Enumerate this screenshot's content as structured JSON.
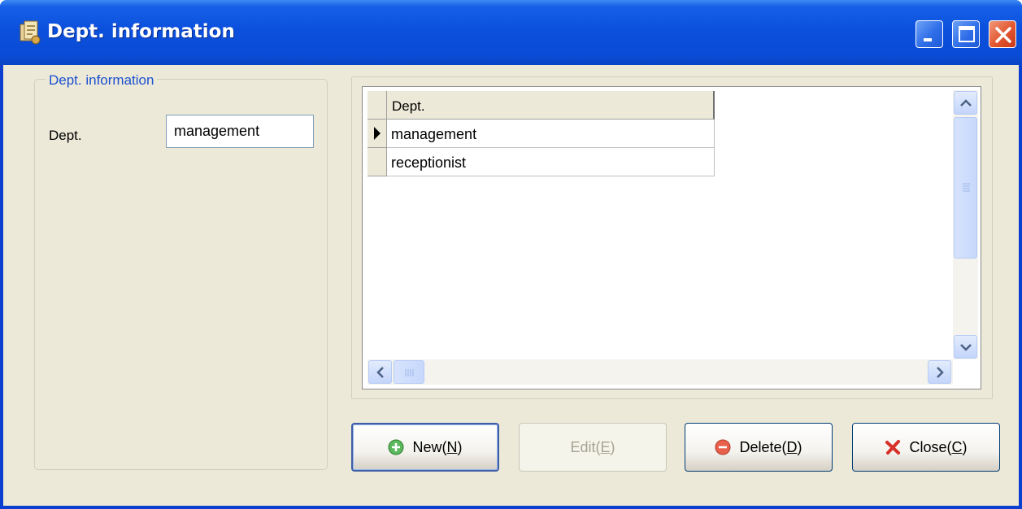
{
  "window": {
    "title": "Dept. information",
    "controls": {
      "minimize": "minimize-icon",
      "maximize": "maximize-icon",
      "close": "close-icon"
    }
  },
  "group": {
    "legend": "Dept. information",
    "dept_label": "Dept.",
    "dept_value": "management"
  },
  "grid": {
    "column_header": "Dept.",
    "rows": [
      {
        "value": "management",
        "current": true
      },
      {
        "value": "receptionist",
        "current": false
      }
    ]
  },
  "buttons": {
    "new": {
      "text": "New(",
      "key": "N",
      "end": ")",
      "icon": "plus-circle-icon",
      "enabled": true
    },
    "edit": {
      "text": "Edit(",
      "key": "E",
      "end": ")",
      "enabled": false
    },
    "delete": {
      "text": "Delete(",
      "key": "D",
      "end": ")",
      "icon": "minus-circle-icon",
      "enabled": true
    },
    "close": {
      "text": "Close(",
      "key": "C",
      "end": ")",
      "icon": "red-x-icon",
      "enabled": true
    }
  },
  "colors": {
    "titlebar": "#0a4bd6",
    "client_background": "#ece9d8",
    "legend_text": "#1a4fd0",
    "close_button": "#e2562f"
  }
}
